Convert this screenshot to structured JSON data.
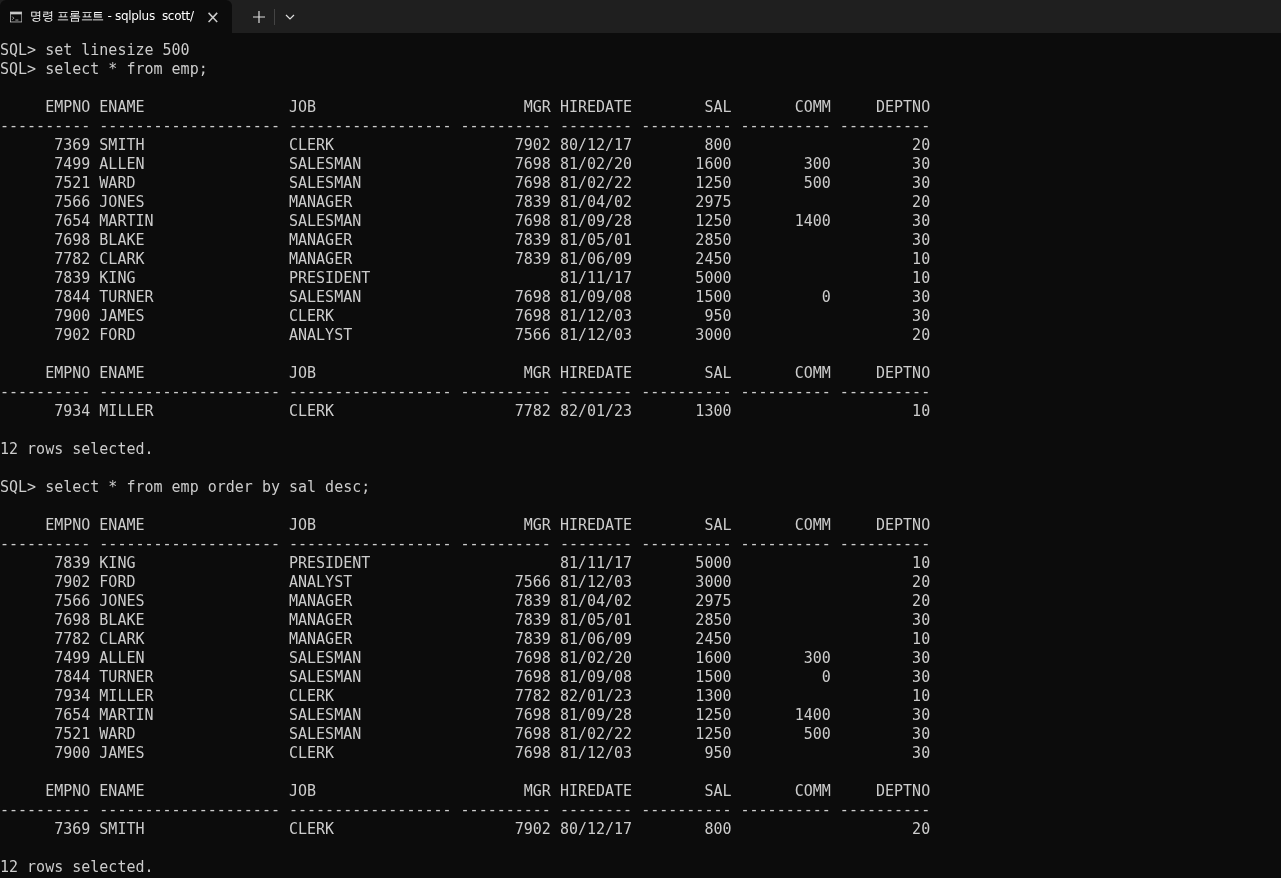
{
  "tab": {
    "title": "명령 프롬프트 - sqlplus  scott/",
    "close": "×",
    "selected": true
  },
  "terminal": [
    {
      "kind": "command",
      "prompt": "SQL>",
      "text": "set linesize 500"
    },
    {
      "kind": "command",
      "prompt": "SQL>",
      "text": "select * from emp;"
    },
    {
      "kind": "table_page",
      "header": "     EMPNO ENAME                JOB                       MGR HIREDATE        SAL       COMM     DEPTNO",
      "rule": "---------- -------------------- ------------------ ---------- -------- ---------- ---------- ----------",
      "rows": [
        [
          "7369",
          "SMITH",
          "CLERK",
          "7902",
          "80/12/17",
          "800",
          null,
          "20"
        ],
        [
          "7499",
          "ALLEN",
          "SALESMAN",
          "7698",
          "81/02/20",
          "1600",
          "300",
          "30"
        ],
        [
          "7521",
          "WARD",
          "SALESMAN",
          "7698",
          "81/02/22",
          "1250",
          "500",
          "30"
        ],
        [
          "7566",
          "JONES",
          "MANAGER",
          "7839",
          "81/04/02",
          "2975",
          null,
          "20"
        ],
        [
          "7654",
          "MARTIN",
          "SALESMAN",
          "7698",
          "81/09/28",
          "1250",
          "1400",
          "30"
        ],
        [
          "7698",
          "BLAKE",
          "MANAGER",
          "7839",
          "81/05/01",
          "2850",
          null,
          "30"
        ],
        [
          "7782",
          "CLARK",
          "MANAGER",
          "7839",
          "81/06/09",
          "2450",
          null,
          "10"
        ],
        [
          "7839",
          "KING",
          "PRESIDENT",
          null,
          "81/11/17",
          "5000",
          null,
          "10"
        ],
        [
          "7844",
          "TURNER",
          "SALESMAN",
          "7698",
          "81/09/08",
          "1500",
          "0",
          "30"
        ],
        [
          "7900",
          "JAMES",
          "CLERK",
          "7698",
          "81/12/03",
          "950",
          null,
          "30"
        ],
        [
          "7902",
          "FORD",
          "ANALYST",
          "7566",
          "81/12/03",
          "3000",
          null,
          "20"
        ]
      ]
    },
    {
      "kind": "table_page",
      "header": "     EMPNO ENAME                JOB                       MGR HIREDATE        SAL       COMM     DEPTNO",
      "rule": "---------- -------------------- ------------------ ---------- -------- ---------- ---------- ----------",
      "rows": [
        [
          "7934",
          "MILLER",
          "CLERK",
          "7782",
          "82/01/23",
          "1300",
          null,
          "10"
        ]
      ]
    },
    {
      "kind": "message",
      "text": "12 rows selected."
    },
    {
      "kind": "command",
      "prompt": "SQL>",
      "text": "select * from emp order by sal desc;"
    },
    {
      "kind": "table_page",
      "header": "     EMPNO ENAME                JOB                       MGR HIREDATE        SAL       COMM     DEPTNO",
      "rule": "---------- -------------------- ------------------ ---------- -------- ---------- ---------- ----------",
      "rows": [
        [
          "7839",
          "KING",
          "PRESIDENT",
          null,
          "81/11/17",
          "5000",
          null,
          "10"
        ],
        [
          "7902",
          "FORD",
          "ANALYST",
          "7566",
          "81/12/03",
          "3000",
          null,
          "20"
        ],
        [
          "7566",
          "JONES",
          "MANAGER",
          "7839",
          "81/04/02",
          "2975",
          null,
          "20"
        ],
        [
          "7698",
          "BLAKE",
          "MANAGER",
          "7839",
          "81/05/01",
          "2850",
          null,
          "30"
        ],
        [
          "7782",
          "CLARK",
          "MANAGER",
          "7839",
          "81/06/09",
          "2450",
          null,
          "10"
        ],
        [
          "7499",
          "ALLEN",
          "SALESMAN",
          "7698",
          "81/02/20",
          "1600",
          "300",
          "30"
        ],
        [
          "7844",
          "TURNER",
          "SALESMAN",
          "7698",
          "81/09/08",
          "1500",
          "0",
          "30"
        ],
        [
          "7934",
          "MILLER",
          "CLERK",
          "7782",
          "82/01/23",
          "1300",
          null,
          "10"
        ],
        [
          "7654",
          "MARTIN",
          "SALESMAN",
          "7698",
          "81/09/28",
          "1250",
          "1400",
          "30"
        ],
        [
          "7521",
          "WARD",
          "SALESMAN",
          "7698",
          "81/02/22",
          "1250",
          "500",
          "30"
        ],
        [
          "7900",
          "JAMES",
          "CLERK",
          "7698",
          "81/12/03",
          "950",
          null,
          "30"
        ]
      ]
    },
    {
      "kind": "table_page",
      "header": "     EMPNO ENAME                JOB                       MGR HIREDATE        SAL       COMM     DEPTNO",
      "rule": "---------- -------------------- ------------------ ---------- -------- ---------- ---------- ----------",
      "rows": [
        [
          "7369",
          "SMITH",
          "CLERK",
          "7902",
          "80/12/17",
          "800",
          null,
          "20"
        ]
      ]
    },
    {
      "kind": "message",
      "text": "12 rows selected."
    }
  ]
}
